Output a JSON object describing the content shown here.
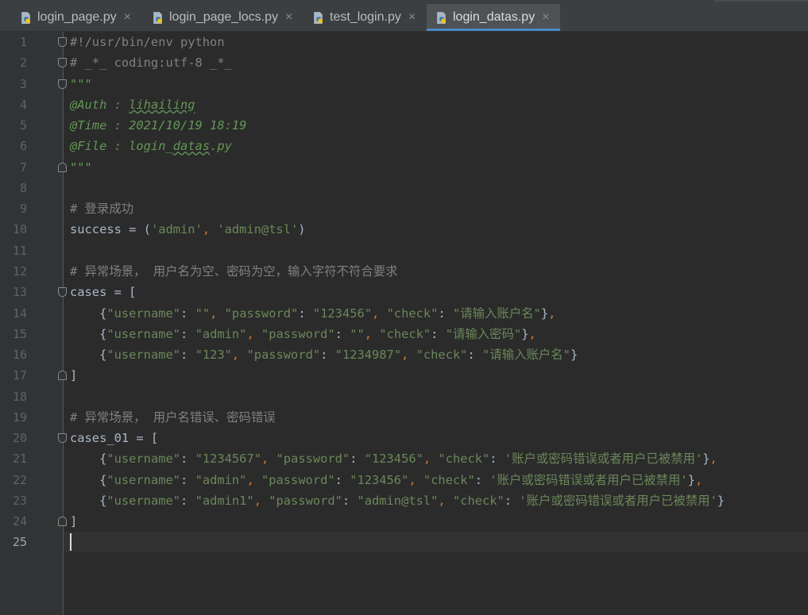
{
  "tabs": [
    {
      "label": "login_page.py",
      "active": false
    },
    {
      "label": "login_page_locs.py",
      "active": false
    },
    {
      "label": "test_login.py",
      "active": false
    },
    {
      "label": "login_datas.py",
      "active": true
    }
  ],
  "tab_close_glyph": "×",
  "current_line": 25,
  "colors": {
    "comment": "#808080",
    "docstring": "#629755",
    "string": "#6a8759",
    "punctuation": "#cc7832",
    "identifier": "#a9b7c6",
    "active_tab_underline": "#4a88c7"
  },
  "lines": [
    {
      "n": 1,
      "fold": "start",
      "tokens": [
        [
          "comment",
          "#!/usr/bin/env python"
        ]
      ]
    },
    {
      "n": 2,
      "fold": "start",
      "tokens": [
        [
          "comment",
          "# _*_ coding:utf-8 _*_"
        ]
      ]
    },
    {
      "n": 3,
      "fold": "start",
      "tokens": [
        [
          "doc",
          "\"\"\""
        ]
      ]
    },
    {
      "n": 4,
      "fold": "",
      "tokens": [
        [
          "doc",
          "@Auth : "
        ],
        [
          "docsq",
          "lihailing"
        ]
      ]
    },
    {
      "n": 5,
      "fold": "",
      "tokens": [
        [
          "doc",
          "@Time : 2021/10/19 18:19"
        ]
      ]
    },
    {
      "n": 6,
      "fold": "",
      "tokens": [
        [
          "doc",
          "@File : login_"
        ],
        [
          "docsq",
          "datas"
        ],
        [
          "doc",
          ".py"
        ]
      ]
    },
    {
      "n": 7,
      "fold": "end",
      "tokens": [
        [
          "doc",
          "\"\"\""
        ]
      ]
    },
    {
      "n": 8,
      "fold": "",
      "tokens": []
    },
    {
      "n": 9,
      "fold": "",
      "tokens": [
        [
          "comment",
          "# 登录成功"
        ]
      ]
    },
    {
      "n": 10,
      "fold": "",
      "tokens": [
        [
          "plain",
          "success = ("
        ],
        [
          "str",
          "'admin'"
        ],
        [
          "punc",
          ", "
        ],
        [
          "str",
          "'admin@tsl'"
        ],
        [
          "plain",
          ")"
        ]
      ]
    },
    {
      "n": 11,
      "fold": "",
      "tokens": []
    },
    {
      "n": 12,
      "fold": "",
      "tokens": [
        [
          "comment",
          "# 异常场景， 用户名为空、密码为空，输入字符不符合要求"
        ]
      ]
    },
    {
      "n": 13,
      "fold": "start",
      "tokens": [
        [
          "plain",
          "cases = ["
        ]
      ]
    },
    {
      "n": 14,
      "fold": "",
      "tokens": [
        [
          "plain",
          "    {"
        ],
        [
          "str",
          "\"username\""
        ],
        [
          "plain",
          ": "
        ],
        [
          "str",
          "\"\""
        ],
        [
          "punc",
          ", "
        ],
        [
          "str",
          "\"password\""
        ],
        [
          "plain",
          ": "
        ],
        [
          "str",
          "\"123456\""
        ],
        [
          "punc",
          ", "
        ],
        [
          "str",
          "\"check\""
        ],
        [
          "plain",
          ": "
        ],
        [
          "str",
          "\"请输入账户名\""
        ],
        [
          "plain",
          "}"
        ],
        [
          "punc",
          ","
        ]
      ]
    },
    {
      "n": 15,
      "fold": "",
      "tokens": [
        [
          "plain",
          "    {"
        ],
        [
          "str",
          "\"username\""
        ],
        [
          "plain",
          ": "
        ],
        [
          "str",
          "\"admin\""
        ],
        [
          "punc",
          ", "
        ],
        [
          "str",
          "\"password\""
        ],
        [
          "plain",
          ": "
        ],
        [
          "str",
          "\"\""
        ],
        [
          "punc",
          ", "
        ],
        [
          "str",
          "\"check\""
        ],
        [
          "plain",
          ": "
        ],
        [
          "str",
          "\"请输入密码\""
        ],
        [
          "plain",
          "}"
        ],
        [
          "punc",
          ","
        ]
      ]
    },
    {
      "n": 16,
      "fold": "",
      "tokens": [
        [
          "plain",
          "    {"
        ],
        [
          "str",
          "\"username\""
        ],
        [
          "plain",
          ": "
        ],
        [
          "str",
          "\"123\""
        ],
        [
          "punc",
          ", "
        ],
        [
          "str",
          "\"password\""
        ],
        [
          "plain",
          ": "
        ],
        [
          "str",
          "\"1234987\""
        ],
        [
          "punc",
          ", "
        ],
        [
          "str",
          "\"check\""
        ],
        [
          "plain",
          ": "
        ],
        [
          "str",
          "\"请输入账户名\""
        ],
        [
          "plain",
          "}"
        ]
      ]
    },
    {
      "n": 17,
      "fold": "end",
      "tokens": [
        [
          "plain",
          "]"
        ]
      ]
    },
    {
      "n": 18,
      "fold": "",
      "tokens": []
    },
    {
      "n": 19,
      "fold": "",
      "tokens": [
        [
          "comment",
          "# 异常场景， 用户名错误、密码错误"
        ]
      ]
    },
    {
      "n": 20,
      "fold": "start",
      "tokens": [
        [
          "plain",
          "cases_01 = ["
        ]
      ]
    },
    {
      "n": 21,
      "fold": "",
      "tokens": [
        [
          "plain",
          "    {"
        ],
        [
          "str",
          "\"username\""
        ],
        [
          "plain",
          ": "
        ],
        [
          "str",
          "\"1234567\""
        ],
        [
          "punc",
          ", "
        ],
        [
          "str",
          "\"password\""
        ],
        [
          "plain",
          ": "
        ],
        [
          "str",
          "\"123456\""
        ],
        [
          "punc",
          ", "
        ],
        [
          "str",
          "\"check\""
        ],
        [
          "plain",
          ": "
        ],
        [
          "str",
          "'账户或密码错误或者用户已被禁用'"
        ],
        [
          "plain",
          "}"
        ],
        [
          "punc",
          ","
        ]
      ]
    },
    {
      "n": 22,
      "fold": "",
      "tokens": [
        [
          "plain",
          "    {"
        ],
        [
          "str",
          "\"username\""
        ],
        [
          "plain",
          ": "
        ],
        [
          "str",
          "\"admin\""
        ],
        [
          "punc",
          ", "
        ],
        [
          "str",
          "\"password\""
        ],
        [
          "plain",
          ": "
        ],
        [
          "str",
          "\"123456\""
        ],
        [
          "punc",
          ", "
        ],
        [
          "str",
          "\"check\""
        ],
        [
          "plain",
          ": "
        ],
        [
          "str",
          "'账户或密码错误或者用户已被禁用'"
        ],
        [
          "plain",
          "}"
        ],
        [
          "punc",
          ","
        ]
      ]
    },
    {
      "n": 23,
      "fold": "",
      "tokens": [
        [
          "plain",
          "    {"
        ],
        [
          "str",
          "\"username\""
        ],
        [
          "plain",
          ": "
        ],
        [
          "str",
          "\"admin1\""
        ],
        [
          "punc",
          ", "
        ],
        [
          "str",
          "\"password\""
        ],
        [
          "plain",
          ": "
        ],
        [
          "str",
          "\"admin@tsl\""
        ],
        [
          "punc",
          ", "
        ],
        [
          "str",
          "\"check\""
        ],
        [
          "plain",
          ": "
        ],
        [
          "str",
          "'账户或密码错误或者用户已被禁用'"
        ],
        [
          "plain",
          "}"
        ]
      ]
    },
    {
      "n": 24,
      "fold": "end",
      "tokens": [
        [
          "plain",
          "]"
        ]
      ]
    },
    {
      "n": 25,
      "fold": "",
      "tokens": []
    }
  ]
}
